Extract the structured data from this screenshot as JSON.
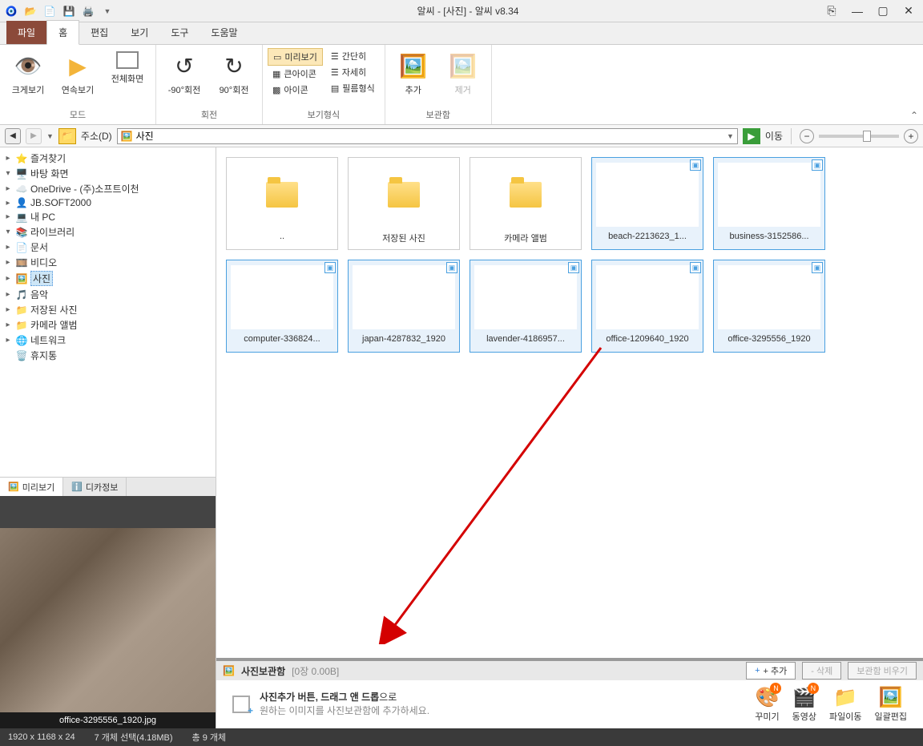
{
  "title": "알씨 - [사진] - 알씨 v8.34",
  "ribbon_tabs": {
    "file": "파일",
    "home": "홈",
    "edit": "편집",
    "view": "보기",
    "tool": "도구",
    "help": "도움말"
  },
  "ribbon": {
    "mode_label": "모드",
    "mode": {
      "big": "크게보기",
      "cont": "연속보기",
      "full": "전체화면"
    },
    "rotate_label": "회전",
    "rotate": {
      "ccw": "-90°회전",
      "cw": "90°회전"
    },
    "viewfmt_label": "보기형식",
    "viewfmt": {
      "preview": "미리보기",
      "simple": "간단히",
      "bigicon": "큰아이콘",
      "detail": "자세히",
      "icon": "아이콘",
      "film": "필름형식"
    },
    "basket_label": "보관함",
    "basket": {
      "add": "추가",
      "remove": "제거"
    }
  },
  "addr": {
    "label": "주소(D)",
    "value": "사진",
    "go": "이동"
  },
  "tree": {
    "fav": "즐겨찾기",
    "desktop": "바탕 화면",
    "onedrive": "OneDrive - (주)소프트이천",
    "jb": "JB.SOFT2000",
    "pc": "내 PC",
    "lib": "라이브러리",
    "doc": "문서",
    "video": "비디오",
    "photo": "사진",
    "music": "음악",
    "saved": "저장된 사진",
    "camera": "카메라 앨범",
    "net": "네트워크",
    "trash": "휴지통"
  },
  "preview_tabs": {
    "preview": "미리보기",
    "exif": "디카정보"
  },
  "preview_caption": "office-3295556_1920.jpg",
  "thumbs": {
    "up": "..",
    "saved": "저장된 사진",
    "camera": "카메라 앨범",
    "beach": "beach-2213623_1...",
    "biz": "business-3152586...",
    "comp": "computer-336824...",
    "japan": "japan-4287832_1920",
    "lav": "lavender-4186957...",
    "off1": "office-1209640_1920",
    "off2": "office-3295556_1920"
  },
  "basket": {
    "title": "사진보관함",
    "count": "[0장 0.00B]",
    "add": "+ 추가",
    "del": "- 삭제",
    "empty": "보관함 비우기",
    "hint1_bold": "사진추가 버튼, 드래그 앤 드롭",
    "hint1_tail": "으로",
    "hint2": "원하는 이미지를 사진보관함에 추가하세요.",
    "actions": {
      "decorate": "꾸미기",
      "video": "동영상",
      "move": "파일이동",
      "batch": "일괄편집"
    }
  },
  "status": {
    "dim": "1920 x 1168 x 24",
    "sel": "7 개체 선택(4.18MB)",
    "total": "총 9 개체"
  }
}
